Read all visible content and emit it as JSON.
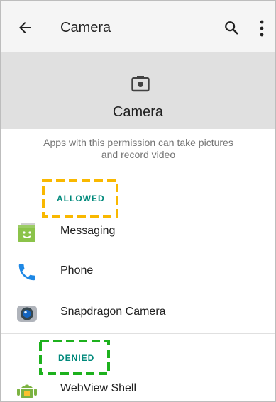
{
  "appbar": {
    "title": "Camera",
    "back_icon": "arrow-back-icon",
    "search_icon": "search-icon",
    "more_icon": "more-vert-icon"
  },
  "header": {
    "title": "Camera",
    "icon": "camera-icon"
  },
  "description": "Apps with this permission can take pictures and record video",
  "sections": {
    "allowed": {
      "label": "ALLOWED",
      "highlight_color": "#f9b800",
      "apps": [
        {
          "label": "Messaging",
          "icon": "messaging-app-icon"
        },
        {
          "label": "Phone",
          "icon": "phone-app-icon"
        },
        {
          "label": "Snapdragon Camera",
          "icon": "snapdragon-camera-app-icon"
        }
      ]
    },
    "denied": {
      "label": "DENIED",
      "highlight_color": "#1db11d",
      "apps": [
        {
          "label": "WebView Shell",
          "icon": "android-app-icon"
        }
      ]
    }
  },
  "colors": {
    "accent": "#00897b",
    "appbar_bg": "#f5f5f5",
    "header_bg": "#e0e0e0"
  }
}
